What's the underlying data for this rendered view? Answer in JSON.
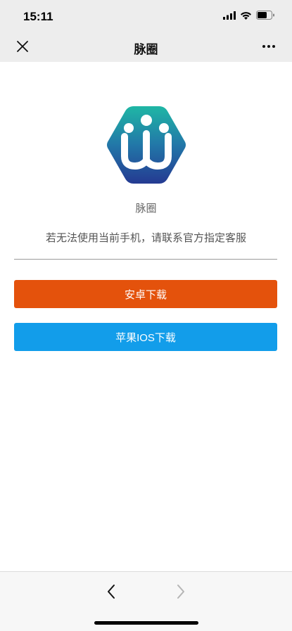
{
  "status_bar": {
    "time": "15:11",
    "icons": [
      "cellular-signal-icon",
      "wifi-icon",
      "battery-icon"
    ]
  },
  "nav_bar": {
    "title": "脉圈",
    "close_icon": "close-icon",
    "more_icon": "more-dots-icon"
  },
  "app": {
    "name": "脉圈",
    "logo_icon": "app-logo-icon",
    "hint": "若无法使用当前手机，请联系官方指定客服"
  },
  "buttons": {
    "android_label": "安卓下载",
    "ios_label": "苹果IOS下载",
    "android_color": "#e4520c",
    "ios_color": "#129dea"
  },
  "bottom_bar": {
    "back_icon": "chevron-left-icon",
    "forward_icon": "chevron-right-icon"
  }
}
